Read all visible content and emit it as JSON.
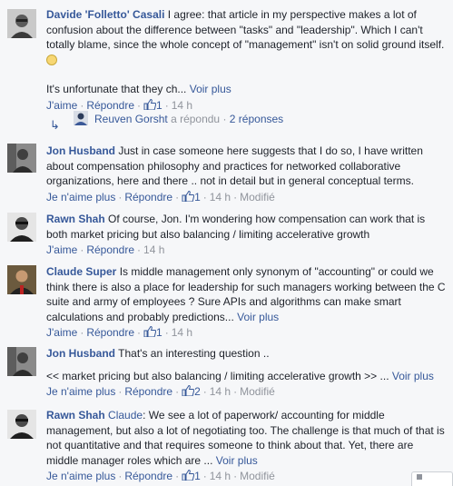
{
  "comments": [
    {
      "author": "Davide 'Folletto' Casali",
      "text": "I agree: that article in my perspective makes a lot of confusion about the difference between \"tasks\" and \"leadership\". Which I can't totally blame, since the whole concept of \"management\" isn't on solid ground itself.",
      "text2": "It's unfortunate that they ch...",
      "more": "Voir plus",
      "like": "J'aime",
      "reply": "Répondre",
      "likes": "1",
      "time": "14 h"
    },
    {
      "author": "Jon Husband",
      "text": "Just in case someone here suggests that I do so, I have written about compensation philosophy and practices for networked collaborative organizations, here and there .. not in detail but in general conceptual terms.",
      "like": "Je n'aime plus",
      "reply": "Répondre",
      "likes": "1",
      "time": "14 h",
      "edited": "Modifié"
    },
    {
      "author": "Rawn Shah",
      "text": "Of course, Jon. I'm wondering how compensation can work that is both market pricing but also balancing / limiting accelerative growth",
      "like": "J'aime",
      "reply": "Répondre",
      "time": "14 h"
    },
    {
      "author": "Claude Super",
      "text": "Is middle management only synonym of \"accounting\" or could we think there is also a place for leadership for such managers working between the C suite and army of employees ? Sure APIs and algorithms can make smart calculations and probably predictions...",
      "more": "Voir plus",
      "like": "J'aime",
      "reply": "Répondre",
      "likes": "1",
      "time": "14 h"
    },
    {
      "author": "Jon Husband",
      "text": "That's an interesting question ..",
      "text2": "<< market pricing but also balancing / limiting accelerative growth >> ...",
      "more": "Voir plus",
      "like": "Je n'aime plus",
      "reply": "Répondre",
      "likes": "2",
      "time": "14 h",
      "edited": "Modifié"
    },
    {
      "author": "Rawn Shah",
      "mention": "Claude",
      "text": ": We see a lot of paperwork/ accounting for middle management, but also a lot of negotiating too. The challenge is that much of that is not quantitative and that requires someone to think about that. Yet, there are middle manager roles which are ...",
      "more": "Voir plus",
      "like": "Je n'aime plus",
      "reply": "Répondre",
      "likes": "1",
      "time": "14 h",
      "edited": "Modifié"
    }
  ],
  "reply_thread": {
    "author": "Reuven Gorsht",
    "action": "a répondu",
    "count": "2 réponses"
  },
  "colors": {
    "link": "#365899",
    "muted": "#90949c",
    "text": "#1d2129",
    "background": "#f6f7f9"
  },
  "icons": {
    "like": "thumbs-up-icon",
    "reply": "reply-arrow-icon"
  }
}
